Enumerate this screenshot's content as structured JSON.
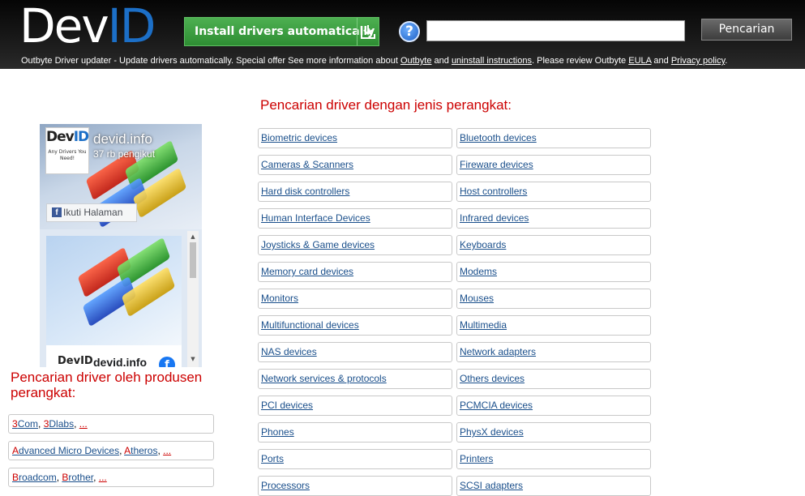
{
  "header": {
    "logo": {
      "dev": "Dev",
      "id": "ID"
    },
    "install_button": "Install drivers automatically",
    "help_symbol": "?",
    "search_value": "",
    "search_button": "Pencarian",
    "promo": {
      "text1": "Outbyte Driver updater - Update drivers automatically. Special offer See more information about ",
      "link_outbyte": "Outbyte",
      "text2": " and ",
      "link_uninstall": "uninstall instructions",
      "text3": ". Please review Outbyte ",
      "link_eula": "EULA",
      "text4": " and ",
      "link_privacy": "Privacy policy",
      "text5": "."
    }
  },
  "facebook_widget": {
    "logo_dev": "Dev",
    "logo_id": "ID",
    "logo_tagline": "Any Drivers You Need!",
    "page_name": "devid.info",
    "followers": "37 rb pengikut",
    "follow_button": "Ikuti Halaman",
    "post_logo": "DevID",
    "post_name": "devid.info"
  },
  "manufacturers": {
    "title": "Pencarian driver oleh produsen perangkat:",
    "rows": [
      {
        "items": [
          {
            "first": "3",
            "rest": "Com"
          },
          {
            "first": "3",
            "rest": "Dlabs"
          }
        ],
        "more": "..."
      },
      {
        "items": [
          {
            "first": "A",
            "rest": "dvanced Micro Devices"
          },
          {
            "first": "A",
            "rest": "theros"
          }
        ],
        "more": "..."
      },
      {
        "items": [
          {
            "first": "B",
            "rest": "roadcom"
          },
          {
            "first": "B",
            "rest": "rother"
          }
        ],
        "more": "..."
      }
    ]
  },
  "categories": {
    "title": "Pencarian driver dengan jenis perangkat:",
    "left": [
      "Biometric devices",
      "Cameras & Scanners",
      "Hard disk controllers",
      "Human Interface Devices",
      "Joysticks & Game devices",
      "Memory card devices",
      "Monitors",
      "Multifunctional devices",
      "NAS devices",
      "Network services & protocols",
      "PCI devices",
      "Phones",
      "Ports",
      "Processors"
    ],
    "right": [
      "Bluetooth devices",
      "Fireware devices",
      "Host controllers",
      "Infrared devices",
      "Keyboards",
      "Modems",
      "Mouses",
      "Multimedia",
      "Network adapters",
      "Others devices",
      "PCMCIA devices",
      "PhysX devices",
      "Printers",
      "SCSI adapters"
    ]
  },
  "colors": {
    "accent_red": "#cc0000",
    "link_blue": "#1a4f8b",
    "install_green": "#3a9e3e",
    "logo_blue": "#1c6fc7"
  }
}
